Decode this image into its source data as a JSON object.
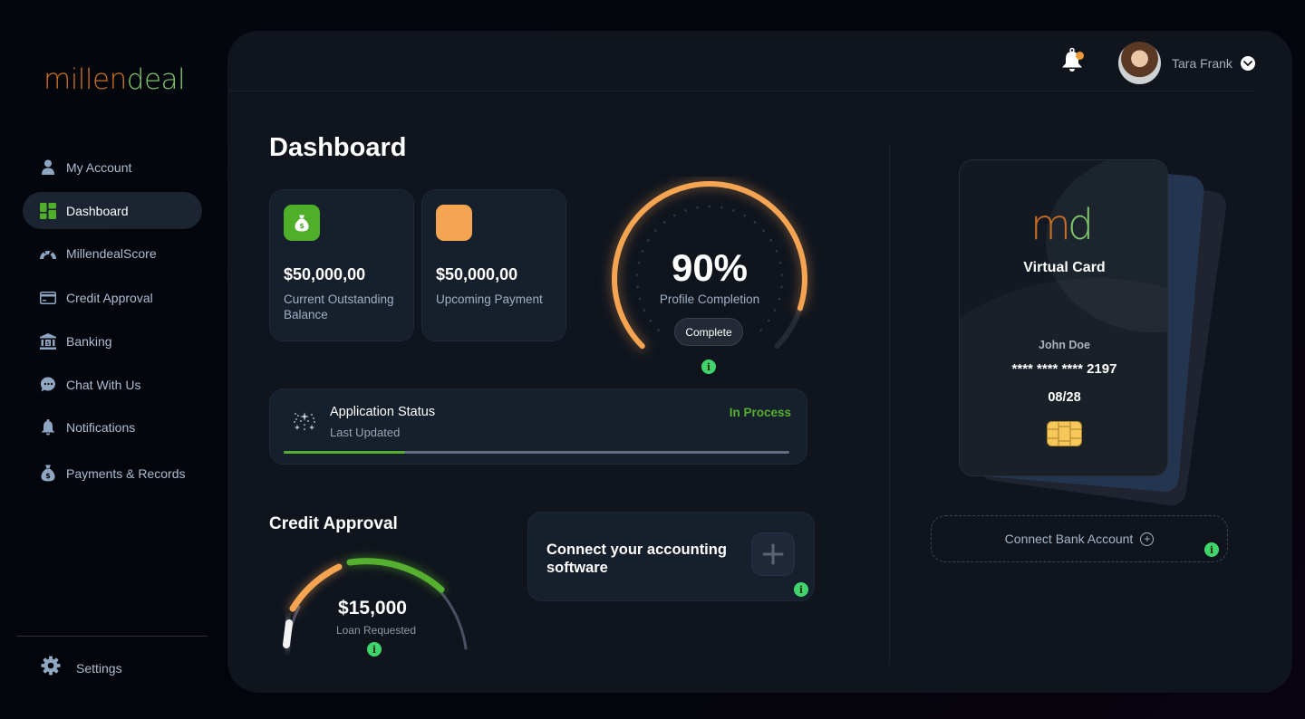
{
  "brand": {
    "part1": "millen",
    "part2": "deal"
  },
  "sidebar": {
    "items": [
      {
        "label": "My Account",
        "icon": "user-icon",
        "active": false
      },
      {
        "label": "Dashboard",
        "icon": "dashboard-icon",
        "active": true
      },
      {
        "label": "MillendealScore",
        "icon": "speedometer-icon",
        "active": false
      },
      {
        "label": "Credit Approval",
        "icon": "credit-card-icon",
        "active": false
      },
      {
        "label": "Banking",
        "icon": "bank-icon",
        "active": false
      },
      {
        "label": "Chat With Us",
        "icon": "chat-icon",
        "active": false
      },
      {
        "label": "Notifications",
        "icon": "bell-icon",
        "active": false
      },
      {
        "label": "Payments & Records",
        "icon": "money-bag-icon",
        "active": false
      }
    ],
    "settings_label": "Settings"
  },
  "header": {
    "notification_badge": "1",
    "user_name": "Tara Frank"
  },
  "main": {
    "title": "Dashboard",
    "stats": [
      {
        "amount": "$50,000,00",
        "label": "Current Outstanding Balance",
        "icon": "money-bag-icon",
        "color": "#4fae2a"
      },
      {
        "amount": "$50,000,00",
        "label": "Upcoming Payment",
        "icon": "blank",
        "color": "#f5a452"
      }
    ],
    "profile": {
      "percent_text": "90%",
      "percent": 90,
      "label": "Profile Completion",
      "button": "Complete"
    },
    "application_status": {
      "title": "Application Status",
      "subtitle": "Last Updated",
      "state": "In Process",
      "progress": 24
    },
    "credit_approval": {
      "title": "Credit Approval",
      "amount": "$15,000",
      "label": "Loan Requested"
    },
    "connect_accounting": {
      "label": "Connect your accounting software"
    }
  },
  "virtual_card": {
    "logo_a": "m",
    "logo_b": "d",
    "title": "Virtual Card",
    "holder": "John Doe",
    "number": "**** **** **** 2197",
    "expiry": "08/28"
  },
  "bank": {
    "label": "Connect Bank Account"
  },
  "colors": {
    "accent_green": "#56b02f",
    "accent_orange": "#f5a452",
    "info_green": "#3ed56c"
  }
}
